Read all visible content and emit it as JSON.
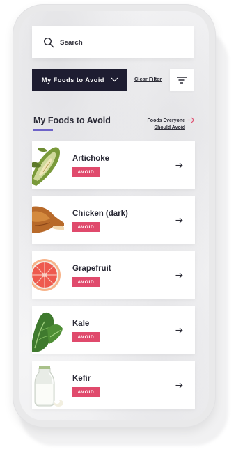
{
  "search": {
    "placeholder": "Search",
    "icon": "search-icon"
  },
  "filter_bar": {
    "dropdown_label": "My Foods to Avoid",
    "clear_filter_label": "Clear Filter",
    "filter_icon": "filter-lines-icon"
  },
  "section": {
    "title": "My Foods to Avoid",
    "link_line1": "Foods Everyone",
    "link_line2": "Should Avoid"
  },
  "foods": [
    {
      "name": "Artichoke",
      "badge": "AVOID",
      "icon": "artichoke-image"
    },
    {
      "name": "Chicken (dark)",
      "badge": "AVOID",
      "icon": "chicken-image"
    },
    {
      "name": "Grapefruit",
      "badge": "AVOID",
      "icon": "grapefruit-image"
    },
    {
      "name": "Kale",
      "badge": "AVOID",
      "icon": "kale-image"
    },
    {
      "name": "Kefir",
      "badge": "AVOID",
      "icon": "kefir-image"
    }
  ],
  "colors": {
    "dark_navy": "#1e1d31",
    "accent_purple": "#6e63c8",
    "avoid_pink": "#e04a6c",
    "link_arrow_red": "#e04a6c"
  }
}
